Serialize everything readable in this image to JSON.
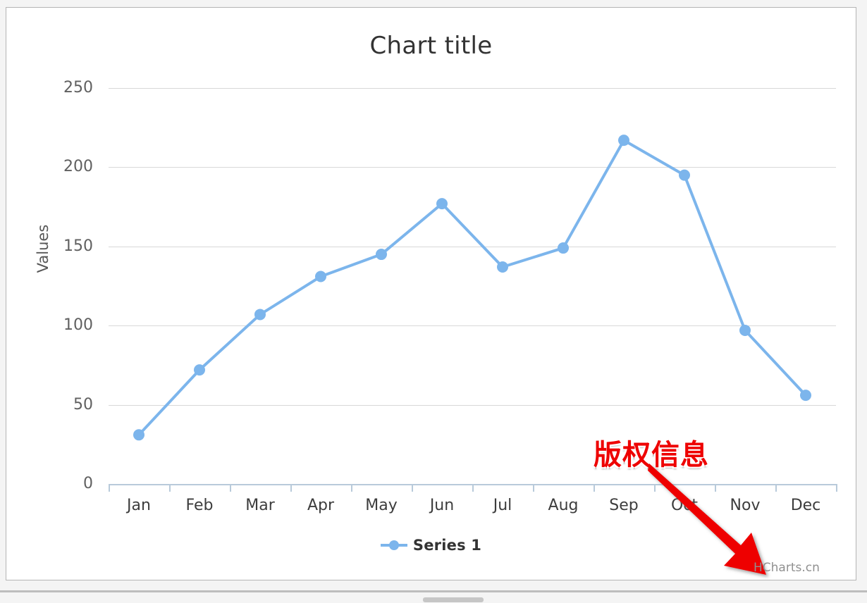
{
  "chart": {
    "title": "Chart title",
    "watermark": "HCharts.cn",
    "annotation": "版权信息",
    "legend_label": "Series 1",
    "accent_color": "#7cb5ec",
    "annotation_color": "#ee0000",
    "axis_label_color": "#606060",
    "gridline_color": "#d8d8d8"
  },
  "chart_data": {
    "type": "line",
    "title": "Chart title",
    "xlabel": "",
    "ylabel": "Values",
    "categories": [
      "Jan",
      "Feb",
      "Mar",
      "Apr",
      "May",
      "Jun",
      "Jul",
      "Aug",
      "Sep",
      "Oct",
      "Nov",
      "Dec"
    ],
    "series": [
      {
        "name": "Series 1",
        "color": "#7cb5ec",
        "values": [
          31,
          72,
          107,
          131,
          145,
          177,
          137,
          149,
          217,
          195,
          97,
          56
        ]
      }
    ],
    "ylim": [
      0,
      250
    ],
    "yticks": [
      0,
      50,
      100,
      150,
      200,
      250
    ],
    "ytick_labels": [
      "0",
      "50",
      "100",
      "150",
      "200",
      "250"
    ],
    "grid": true,
    "legend_position": "bottom"
  }
}
